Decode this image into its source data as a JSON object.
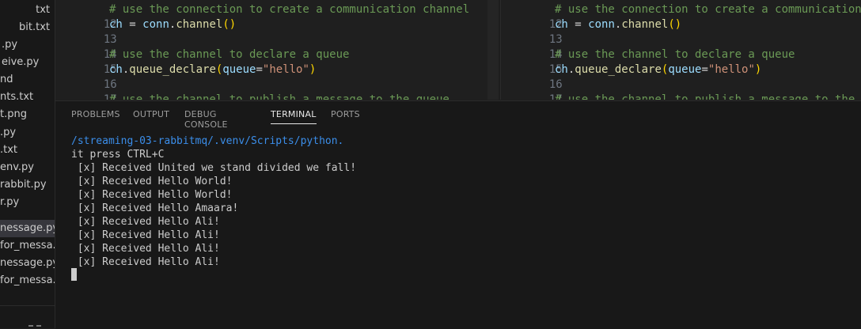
{
  "explorer": {
    "files": [
      {
        "label": "txt",
        "selected": false
      },
      {
        "label": "bit.txt",
        "selected": false
      },
      {
        "label": ".py",
        "selected": false
      },
      {
        "label": "eive.py",
        "selected": false
      },
      {
        "label": "nd",
        "selected": false
      },
      {
        "label": "nts.txt",
        "selected": false
      },
      {
        "label": "t.png",
        "selected": false
      },
      {
        "label": ".py",
        "selected": false
      },
      {
        "label": ".txt",
        "selected": false
      },
      {
        "label": "env.py",
        "selected": false
      },
      {
        "label": "rabbit.py",
        "selected": false
      },
      {
        "label": "r.py",
        "selected": false
      },
      {
        "label": "nessage.py",
        "selected": true
      },
      {
        "label": "for_messa...",
        "selected": false
      },
      {
        "label": "nessage.py",
        "selected": false
      },
      {
        "label": "for_messa...",
        "selected": false
      }
    ]
  },
  "editor_left": {
    "lines": [
      {
        "num": "12",
        "text": "# use the connection to create a communication channel"
      },
      {
        "num": "13",
        "text": "ch = conn.channel()"
      },
      {
        "num": "14",
        "text": ""
      },
      {
        "num": "15",
        "text": "# use the channel to declare a queue"
      },
      {
        "num": "16",
        "text": "ch.queue_declare(queue=\"hello\")"
      },
      {
        "num": "17",
        "text": ""
      },
      {
        "num": "18",
        "text": "# use the channel to publish a message to the queue"
      }
    ]
  },
  "editor_right": {
    "lines": [
      {
        "num": "12",
        "text": "# use the connection to create a communication channel"
      },
      {
        "num": "13",
        "text": "ch = conn.channel()"
      },
      {
        "num": "14",
        "text": ""
      },
      {
        "num": "15",
        "text": "# use the channel to declare a queue"
      },
      {
        "num": "16",
        "text": "ch.queue_declare(queue=\"hello\")"
      },
      {
        "num": "17",
        "text": ""
      },
      {
        "num": "18",
        "text": "# use the channel to publish a message to the queue"
      }
    ]
  },
  "panel": {
    "tabs": {
      "problems": "PROBLEMS",
      "output": "OUTPUT",
      "debug_console": "DEBUG CONSOLE",
      "terminal": "TERMINAL",
      "ports": "PORTS"
    },
    "active_tab": "TERMINAL"
  },
  "terminal": {
    "path_line": "/streaming-03-rabbitmq/.venv/Scripts/python.",
    "lines": [
      "it press CTRL+C",
      " [x] Received United we stand divided we fall!",
      " [x] Received Hello World!",
      " [x] Received Hello World!",
      " [x] Received Hello Amaara!",
      " [x] Received Hello Ali!",
      " [x] Received Hello Ali!",
      " [x] Received Hello Ali!",
      " [x] Received Hello Ali!"
    ]
  },
  "colors": {
    "background": "#1e1e1e",
    "comment": "#6a9955",
    "variable": "#9cdcfe",
    "function": "#dcdcaa",
    "string": "#ce9178",
    "path": "#3b8eea"
  }
}
